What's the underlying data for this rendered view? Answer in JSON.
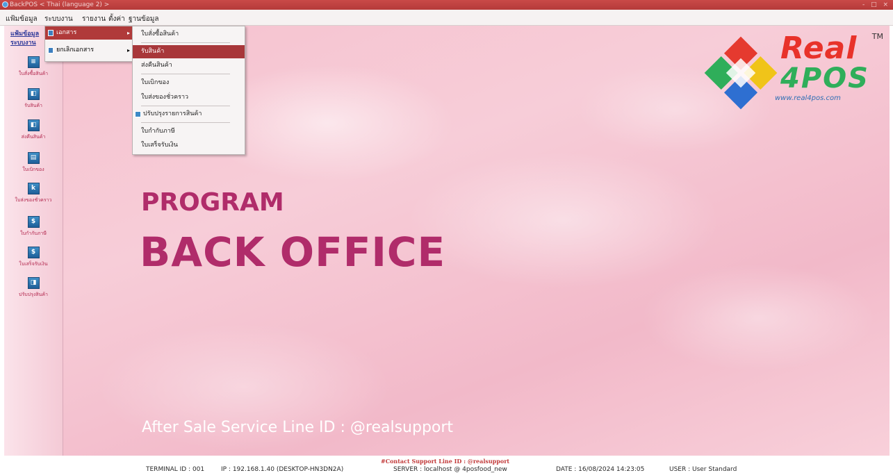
{
  "window": {
    "title": "BackPOS < Thai (language 2) >",
    "controls": "- □ ×"
  },
  "menubar": {
    "items": [
      "แฟ้มข้อมูล",
      "ระบบงาน",
      "รายงาน",
      "ตั้งค่า",
      "ฐานข้อมูล"
    ]
  },
  "left_panel": {
    "headers": [
      "แฟ้มข้อมูล",
      "ระบบงาน"
    ],
    "buttons": [
      {
        "label": "ใบสั่งซื้อสินค้า",
        "icon": "document-icon"
      },
      {
        "label": "รับสินค้า",
        "icon": "receive-goods-icon"
      },
      {
        "label": "ส่งคืนสินค้า",
        "icon": "return-goods-icon"
      },
      {
        "label": "ใบเบิกของ",
        "icon": "requisition-icon"
      },
      {
        "label": "ใบส่งของชั่วคราว",
        "icon": "temporary-delivery-icon"
      },
      {
        "label": "ใบกำกับภาษี",
        "icon": "tax-invoice-icon"
      },
      {
        "label": "ใบเสร็จรับเงิน",
        "icon": "receipt-icon"
      },
      {
        "label": "ปรับปรุงสินค้า",
        "icon": "adjust-stock-icon"
      }
    ]
  },
  "menu_level1": {
    "items": [
      {
        "label": "เอกสาร",
        "highlighted": true
      },
      {
        "label": "ยกเลิกเอกสาร",
        "highlighted": false
      }
    ]
  },
  "menu_level2": {
    "items": [
      "ใบสั่งซื้อสินค้า",
      "รับสินค้า",
      "ส่งคืนสินค้า",
      "ใบเบิกของ",
      "ใบส่งของชั่วคราว",
      "ปรับปรุงรายการสินค้า",
      "ใบกำกับภาษี",
      "ใบเสร็จรับเงิน"
    ],
    "highlighted_index": 1
  },
  "logo": {
    "line1": "Real",
    "line2": "4POS",
    "url": "www.real4pos.com",
    "tm": "TM"
  },
  "banner": {
    "program": "PROGRAM",
    "back_office": "BACK OFFICE",
    "service": "After Sale Service Line ID : @realsupport"
  },
  "status": {
    "contact": "#Contact Support Line ID : @realsupport",
    "terminal": "TERMINAL ID : 001",
    "ip": "IP : 192.168.1.40 (DESKTOP-HN3DN2A)",
    "server": "SERVER : localhost @ 4posfood_new",
    "date": "DATE : 16/08/2024  14:23:05",
    "user": "USER : User Standard"
  },
  "colors": {
    "accent": "#b02c6a",
    "titlebar": "#c94a48",
    "menu_highlight": "#a8373a"
  }
}
